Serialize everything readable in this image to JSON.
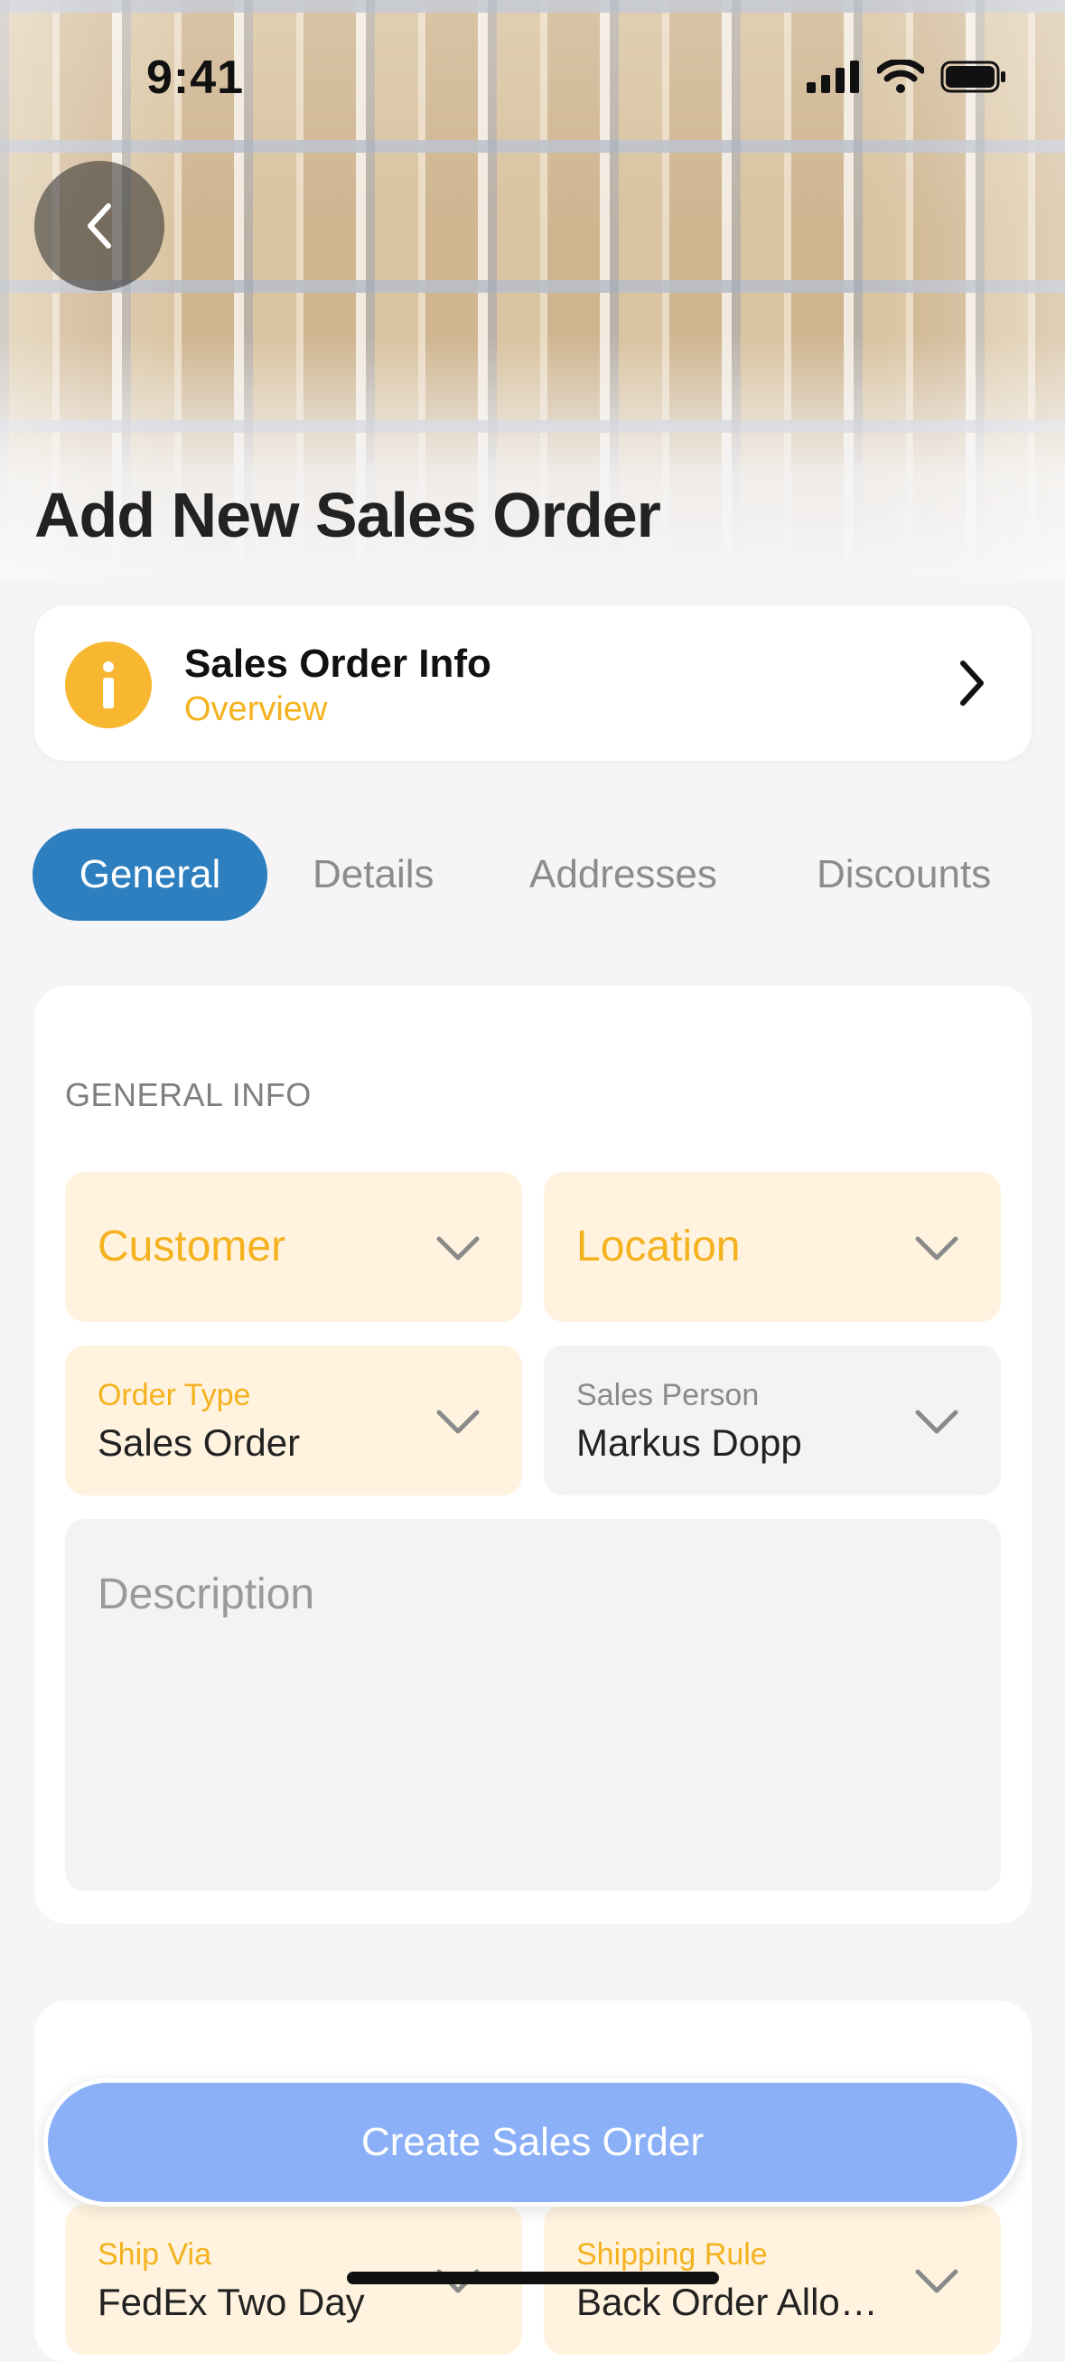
{
  "status_bar": {
    "time": "9:41"
  },
  "page": {
    "title": "Add New Sales Order"
  },
  "info_card": {
    "title": "Sales Order Info",
    "subtitle": "Overview"
  },
  "tabs": [
    {
      "label": "General",
      "active": true
    },
    {
      "label": "Details",
      "active": false
    },
    {
      "label": "Addresses",
      "active": false
    },
    {
      "label": "Discounts",
      "active": false
    }
  ],
  "general_info": {
    "section_label": "GENERAL INFO",
    "customer": {
      "placeholder": "Customer"
    },
    "location": {
      "placeholder": "Location"
    },
    "order_type": {
      "label": "Order Type",
      "value": "Sales Order"
    },
    "sales_person": {
      "label": "Sales Person",
      "value": "Markus Dopp"
    },
    "description": {
      "placeholder": "Description"
    }
  },
  "shipping": {
    "ship_via": {
      "label": "Ship Via",
      "value": "FedEx Two Day"
    },
    "shipping_rule": {
      "label": "Shipping Rule",
      "value": "Back Order Allo…"
    }
  },
  "actions": {
    "create_label": "Create Sales Order"
  },
  "colors": {
    "accent_tab": "#2d7fbf",
    "highlight": "#f5b21f",
    "highlight_bg": "#fff3df",
    "button": "#8cb0f8"
  }
}
